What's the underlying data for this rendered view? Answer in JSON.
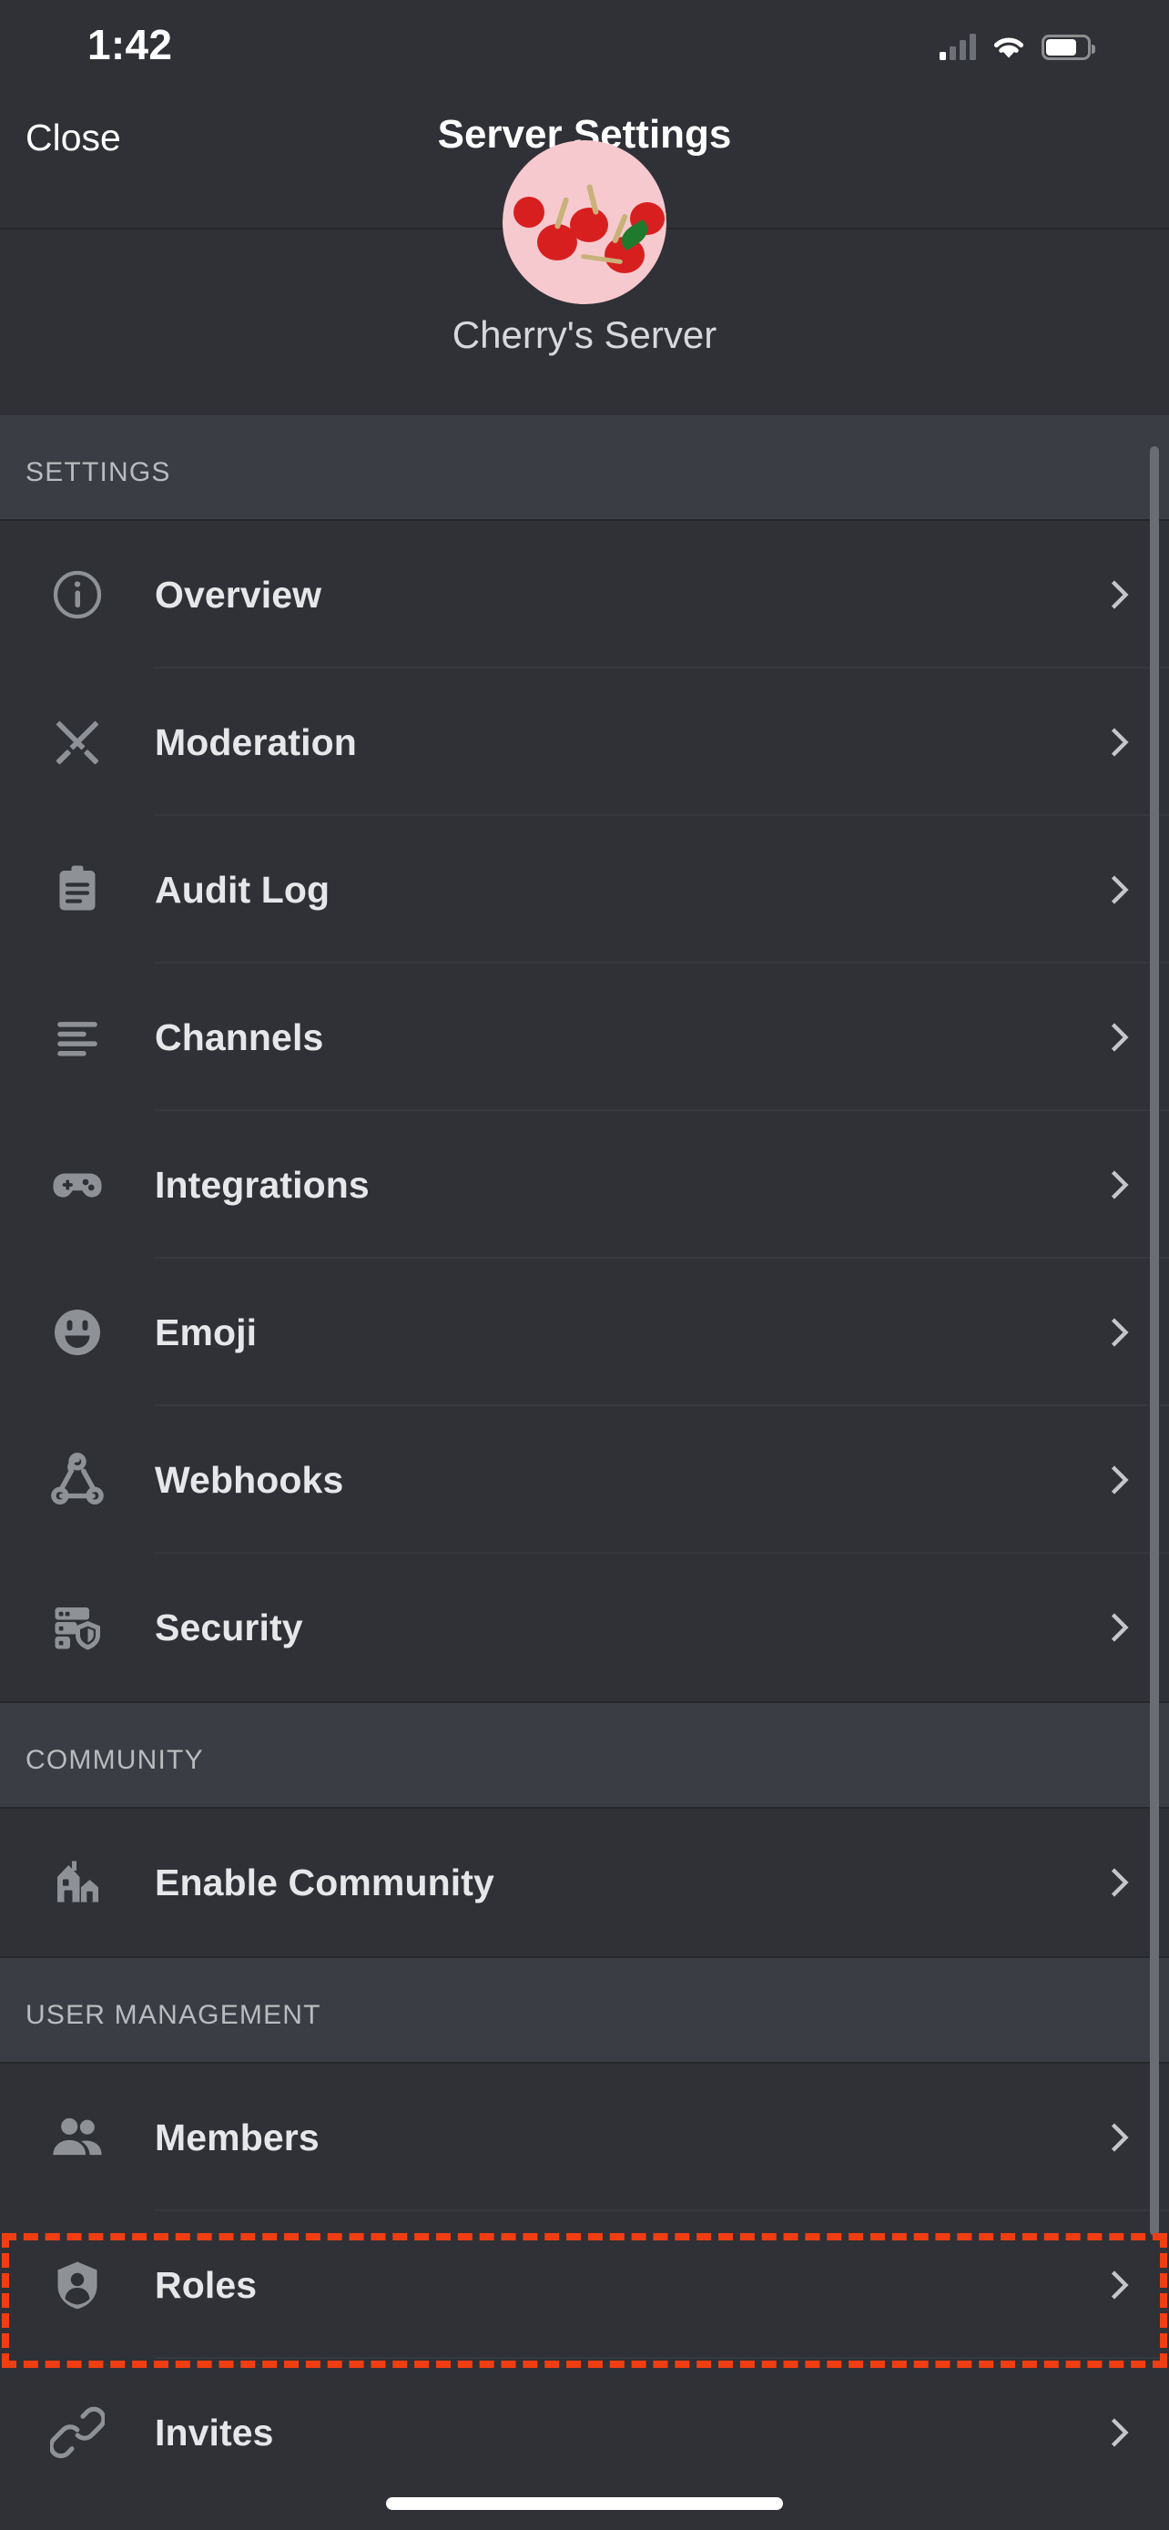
{
  "status_bar": {
    "time": "1:42",
    "cellular_icon": "signal-bars-icon",
    "wifi_icon": "wifi-icon",
    "battery_icon": "battery-icon"
  },
  "nav": {
    "close_label": "Close",
    "title": "Server Settings",
    "close_icon": "close-label-button"
  },
  "server": {
    "name": "Cherry's Server",
    "avatar_icon": "server-avatar"
  },
  "sections": [
    {
      "header": "SETTINGS",
      "items": [
        {
          "label": "Overview",
          "icon": "info-circle-icon",
          "chevron": "chevron-right-icon"
        },
        {
          "label": "Moderation",
          "icon": "crossed-swords-icon",
          "chevron": "chevron-right-icon"
        },
        {
          "label": "Audit Log",
          "icon": "clipboard-icon",
          "chevron": "chevron-right-icon"
        },
        {
          "label": "Channels",
          "icon": "text-lines-icon",
          "chevron": "chevron-right-icon"
        },
        {
          "label": "Integrations",
          "icon": "gamepad-icon",
          "chevron": "chevron-right-icon"
        },
        {
          "label": "Emoji",
          "icon": "smiley-face-icon",
          "chevron": "chevron-right-icon"
        },
        {
          "label": "Webhooks",
          "icon": "webhook-icon",
          "chevron": "chevron-right-icon"
        },
        {
          "label": "Security",
          "icon": "server-shield-icon",
          "chevron": "chevron-right-icon"
        }
      ]
    },
    {
      "header": "COMMUNITY",
      "items": [
        {
          "label": "Enable Community",
          "icon": "houses-icon",
          "chevron": "chevron-right-icon"
        }
      ]
    },
    {
      "header": "USER MANAGEMENT",
      "items": [
        {
          "label": "Members",
          "icon": "people-icon",
          "chevron": "chevron-right-icon"
        },
        {
          "label": "Roles",
          "icon": "shield-person-icon",
          "chevron": "chevron-right-icon"
        },
        {
          "label": "Invites",
          "icon": "link-chain-icon",
          "chevron": "chevron-right-icon"
        }
      ]
    }
  ],
  "highlight": {
    "target_label": "Roles",
    "color": "#f03e12",
    "style": "dashed"
  },
  "colors": {
    "background": "#2f3136",
    "section_header_background": "#3a3d43",
    "nav_background": "#303136",
    "divider": "#36383d",
    "icon": "#8e9297",
    "text_primary": "#e6e7e9",
    "text_secondary": "#b9bbbe",
    "accent_highlight": "#f03e12",
    "scrollbar": "#6a6d73"
  }
}
